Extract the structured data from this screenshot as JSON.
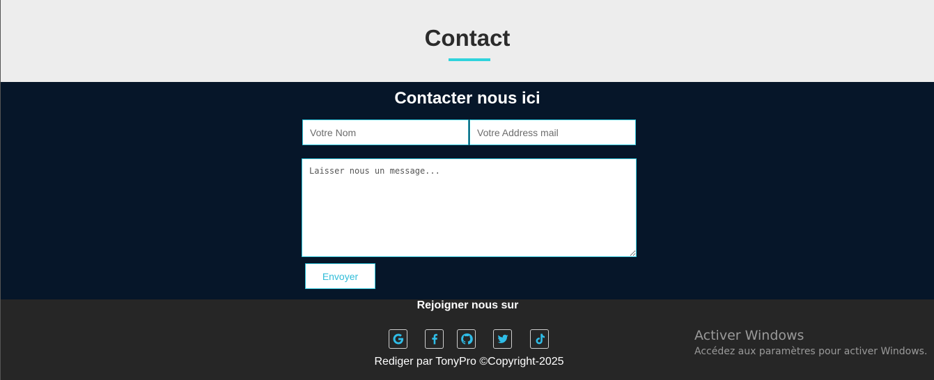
{
  "header": {
    "title": "Contact"
  },
  "contact": {
    "heading": "Contacter nous ici",
    "name_placeholder": "Votre Nom",
    "email_placeholder": "Votre Address mail",
    "message_placeholder": "Laisser nous un message...",
    "submit_label": "Envoyer"
  },
  "footer": {
    "heading": "Rejoigner nous sur",
    "social": [
      {
        "icon": "google-icon"
      },
      {
        "icon": "facebook-icon"
      },
      {
        "icon": "github-icon"
      },
      {
        "icon": "twitter-icon"
      },
      {
        "icon": "tiktok-icon"
      }
    ],
    "copyright": "Rediger par TonyPro ©Copyright-2025"
  },
  "overlay": {
    "title": "Activer Windows",
    "subtitle": "Accédez aux paramètres pour activer Windows."
  },
  "colors": {
    "accent": "#2fd3dc",
    "icon": "#2fbde8",
    "section_bg": "#061629",
    "footer_bg": "#262626"
  }
}
